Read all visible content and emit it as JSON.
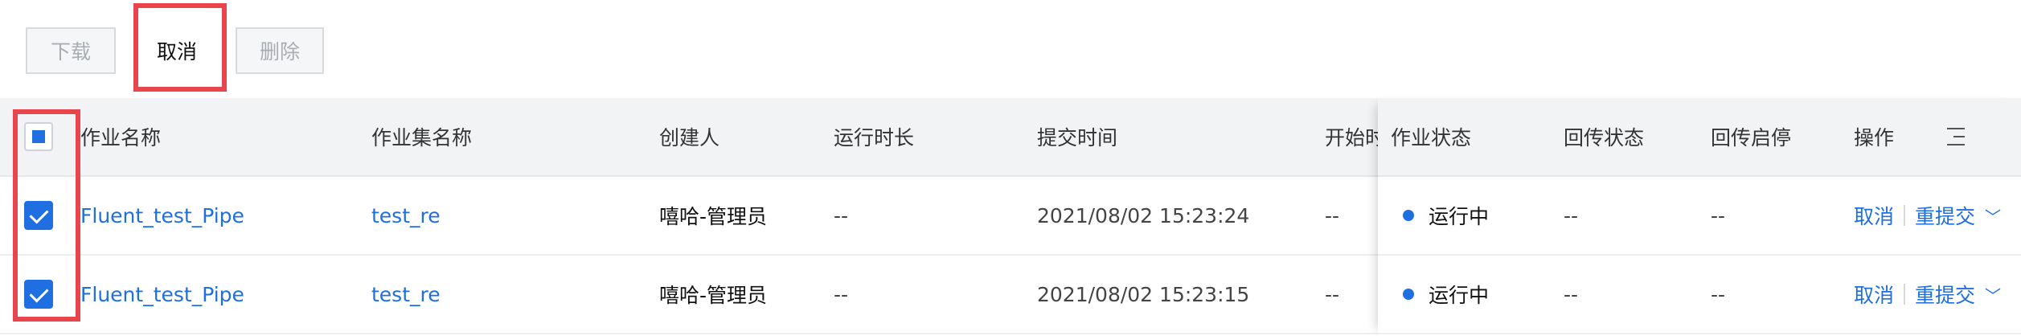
{
  "toolbar": {
    "download_label": "下载",
    "cancel_label": "取消",
    "delete_label": "删除"
  },
  "table": {
    "columns": [
      "作业名称",
      "作业集名称",
      "创建人",
      "运行时长",
      "提交时间",
      "开始时",
      "作业状态",
      "回传状态",
      "回传启停",
      "操作"
    ],
    "rows": [
      {
        "job_name": "Fluent_test_Pipe",
        "jobset_name": "test_re",
        "creator": "嘻哈-管理员",
        "duration": "--",
        "submit_time": "2021/08/02 15:23:24",
        "start_time": "--",
        "status": "运行中",
        "return_status": "--",
        "return_toggle": "--",
        "actions": {
          "cancel": "取消",
          "resubmit": "重提交"
        }
      },
      {
        "job_name": "Fluent_test_Pipe",
        "jobset_name": "test_re",
        "creator": "嘻哈-管理员",
        "duration": "--",
        "submit_time": "2021/08/02 15:23:15",
        "start_time": "--",
        "status": "运行中",
        "return_status": "--",
        "return_toggle": "--",
        "actions": {
          "cancel": "取消",
          "resubmit": "重提交"
        }
      }
    ]
  },
  "colors": {
    "accent": "#1f6fe0",
    "highlight": "#e8464c",
    "header_bg": "#f2f3f5"
  },
  "icons": [
    "check-icon",
    "status-dot-icon",
    "chevron-down-icon",
    "column-settings-icon"
  ]
}
